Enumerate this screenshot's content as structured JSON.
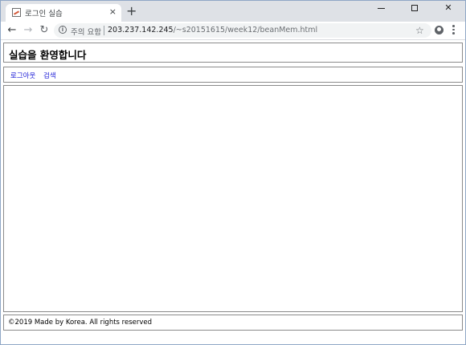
{
  "browser": {
    "tab": {
      "title": "로그인 실습",
      "close_glyph": "×",
      "favicon": "page-favicon-icon"
    },
    "new_tab_glyph": "+",
    "window_controls": {
      "minimize": "minimize-icon",
      "maximize": "maximize-icon",
      "close_glyph": "✕"
    },
    "toolbar": {
      "back_glyph": "←",
      "forward_glyph": "→",
      "reload_glyph": "↻",
      "security_icon_glyph": "i",
      "security_text": "주의 요함",
      "url_host": "203.237.142.245",
      "url_path": "/~s20151615/week12/beanMem.html",
      "star_glyph": "☆"
    }
  },
  "page": {
    "header": {
      "title": "실습을 환영합니다"
    },
    "nav": {
      "logout_label": "로그아웃",
      "search_label": "검색"
    },
    "footer": {
      "text": "©2019 Made by Korea. All rights reserved"
    }
  },
  "colors": {
    "link": "#1a1ad6",
    "box_border": "#8a8a8a",
    "tabstrip_bg": "#dee1e6"
  }
}
